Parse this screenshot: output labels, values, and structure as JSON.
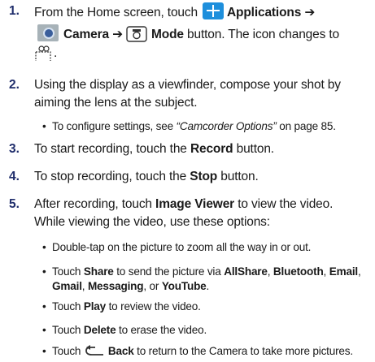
{
  "steps": [
    {
      "num": "1.",
      "prefix": "From the Home screen, touch",
      "applications": "Applications",
      "arrow1": "➔",
      "camera": "Camera",
      "arrow2": "➔",
      "mode": "Mode",
      "button_text": "button. The icon changes to",
      "end": "."
    },
    {
      "num": "2.",
      "line1": "Using the display as a viewfinder, compose your shot by",
      "line2": "aiming the lens at the subject."
    },
    {
      "num": "3.",
      "pre": "To start recording, touch the ",
      "bold": "Record",
      "post": " button."
    },
    {
      "num": "4.",
      "pre": "To stop recording, touch the ",
      "bold": "Stop",
      "post": " button."
    },
    {
      "num": "5.",
      "pre": "After recording, touch ",
      "bold": "Image Viewer",
      "post": " to view the video.",
      "line2": "While viewing the video, use these options:"
    }
  ],
  "config_bullet": {
    "pre": "To configure settings, see ",
    "link": "“Camcorder Options”",
    "post": " on page 85."
  },
  "bullets": {
    "zoom": "Double-tap on the picture to zoom all the way in or out.",
    "share": {
      "touch": "Touch ",
      "share": "Share",
      "mid": " to send the picture via ",
      "allshare": "AllShare",
      "sep1": ", ",
      "bluetooth": "Bluetooth",
      "sep2": ", ",
      "email": "Email",
      "sep3": ",",
      "gmail": "Gmail",
      "sep4": ", ",
      "messaging": "Messaging",
      "or": ", or ",
      "youtube": "YouTube",
      "end": "."
    },
    "play": {
      "touch": "Touch ",
      "bold": "Play",
      "post": " to review the video."
    },
    "delete": {
      "touch": "Touch ",
      "bold": "Delete",
      "post": " to erase the video."
    },
    "back": {
      "touch": "Touch ",
      "bold": "Back",
      "post": " to return to the Camera to take more pictures."
    }
  },
  "icons": {
    "applications": "applications-grid-icon",
    "camera": "camera-app-icon",
    "mode": "camera-mode-icon",
    "camcorder": "camcorder-icon",
    "back": "back-arrow-icon"
  },
  "colors": {
    "step_number": "#1f2d6b",
    "applications_icon": "#1e8fdc"
  }
}
